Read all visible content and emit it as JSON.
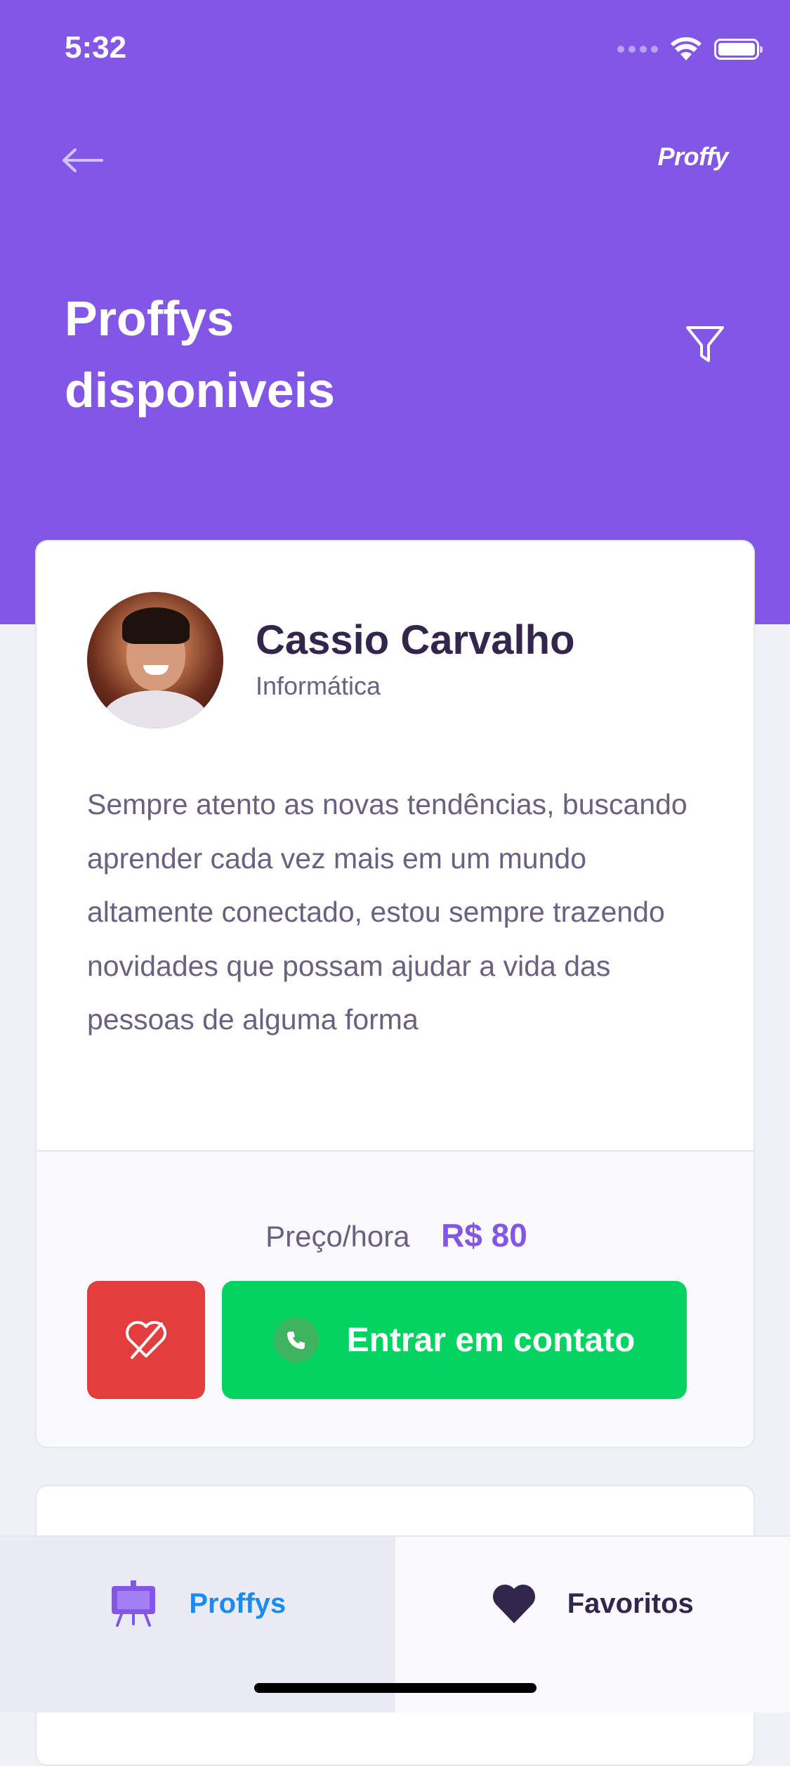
{
  "status_bar": {
    "time": "5:32"
  },
  "header": {
    "brand": "Proffy",
    "title_line1": "Proffys",
    "title_line2": "disponiveis"
  },
  "teacher_card": {
    "name": "Cassio Carvalho",
    "subject": "Informática",
    "bio": "Sempre atento as novas tendências, buscando aprender cada vez mais em um mundo altamente conectado, estou sempre trazendo novidades que possam ajudar a vida das pessoas de alguma forma",
    "price_label": "Preço/hora",
    "price_value": "R$ 80",
    "contact_label": "Entrar em contato"
  },
  "tabbar": {
    "tabs": [
      {
        "label": "Proffys",
        "active": true,
        "icon": "easel-icon"
      },
      {
        "label": "Favoritos",
        "active": false,
        "icon": "heart-icon"
      }
    ]
  },
  "colors": {
    "primary": "#8257E5",
    "background": "#F0F0F7",
    "title_text": "#32264D",
    "body_text": "#6A6180",
    "favorite_remove": "#E33D3D",
    "contact_green": "#04D361",
    "active_tab_text": "#1A8BF0"
  }
}
